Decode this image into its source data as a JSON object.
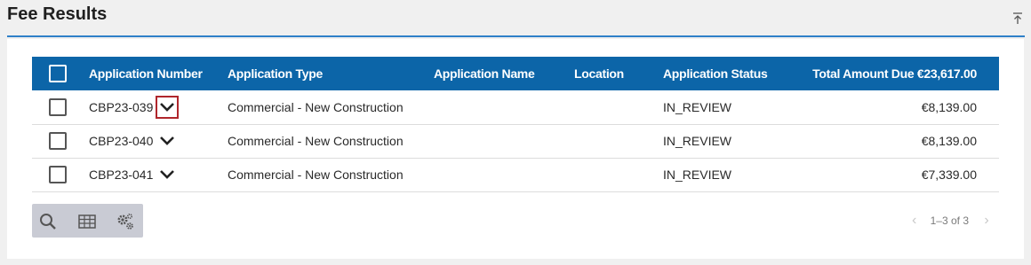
{
  "section": {
    "title": "Fee Results"
  },
  "table": {
    "columns": [
      "Application Number",
      "Application Type",
      "Application Name",
      "Location",
      "Application Status",
      "Total Amount Due €23,617.00"
    ],
    "rows": [
      {
        "number": "CBP23-039",
        "type": "Commercial - New Construction",
        "name": "",
        "location": "",
        "status": "IN_REVIEW",
        "amount": "€8,139.00",
        "checked": false
      },
      {
        "number": "CBP23-040",
        "type": "Commercial - New Construction",
        "name": "",
        "location": "",
        "status": "IN_REVIEW",
        "amount": "€8,139.00",
        "checked": false
      },
      {
        "number": "CBP23-041",
        "type": "Commercial - New Construction",
        "name": "",
        "location": "",
        "status": "IN_REVIEW",
        "amount": "€7,339.00",
        "checked": false
      }
    ]
  },
  "pagination": {
    "range": "1–3 of 3"
  },
  "toolbar": {
    "icons": [
      "search-icon",
      "table-icon",
      "settings-icon"
    ]
  },
  "colors": {
    "header_bg": "#0c65a8",
    "accent_line": "#2f80c8",
    "highlight": "#b0262c"
  }
}
